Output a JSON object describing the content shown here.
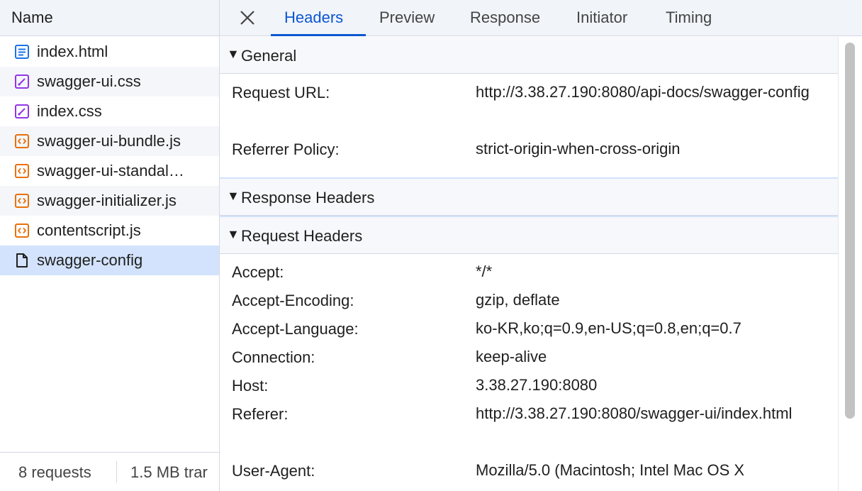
{
  "left_panel": {
    "header": "Name",
    "requests": [
      {
        "name": "index.html",
        "icon": "document-icon",
        "color": "#1a73e8"
      },
      {
        "name": "swagger-ui.css",
        "icon": "stylesheet-icon",
        "color": "#9334e6"
      },
      {
        "name": "index.css",
        "icon": "stylesheet-icon",
        "color": "#9334e6"
      },
      {
        "name": "swagger-ui-bundle.js",
        "icon": "script-icon",
        "color": "#e8710a"
      },
      {
        "name": "swagger-ui-standal…",
        "icon": "script-icon",
        "color": "#e8710a"
      },
      {
        "name": "swagger-initializer.js",
        "icon": "script-icon",
        "color": "#e8710a"
      },
      {
        "name": "contentscript.js",
        "icon": "script-icon",
        "color": "#e8710a"
      },
      {
        "name": "swagger-config",
        "icon": "file-icon",
        "color": "#1f1f1f",
        "selected": true
      }
    ],
    "footer": {
      "count": "8 requests",
      "size": "1.5 MB trar"
    }
  },
  "tabs": [
    {
      "label": "Headers",
      "active": true
    },
    {
      "label": "Preview"
    },
    {
      "label": "Response"
    },
    {
      "label": "Initiator"
    },
    {
      "label": "Timing"
    }
  ],
  "sections": {
    "general": {
      "title": "General",
      "rows": [
        {
          "key": "Request URL:",
          "value": "http://3.38.27.190:8080/api-docs/swagger-config"
        },
        {
          "key": "Referrer Policy:",
          "value": "strict-origin-when-cross-origin"
        }
      ]
    },
    "response_headers": {
      "title": "Response Headers"
    },
    "request_headers": {
      "title": "Request Headers",
      "rows": [
        {
          "key": "Accept:",
          "value": "*/*"
        },
        {
          "key": "Accept-Encoding:",
          "value": "gzip, deflate"
        },
        {
          "key": "Accept-Language:",
          "value": "ko-KR,ko;q=0.9,en-US;q=0.8,en;q=0.7"
        },
        {
          "key": "Connection:",
          "value": "keep-alive"
        },
        {
          "key": "Host:",
          "value": "3.38.27.190:8080"
        },
        {
          "key": "Referer:",
          "value": "http://3.38.27.190:8080/swagger-ui/index.html"
        },
        {
          "key": "User-Agent:",
          "value": "Mozilla/5.0 (Macintosh; Intel Mac OS X"
        }
      ]
    }
  },
  "colors": {
    "accent": "#0b57d0",
    "selected_row": "#d3e3fd",
    "header_bg": "#f1f4f9"
  }
}
